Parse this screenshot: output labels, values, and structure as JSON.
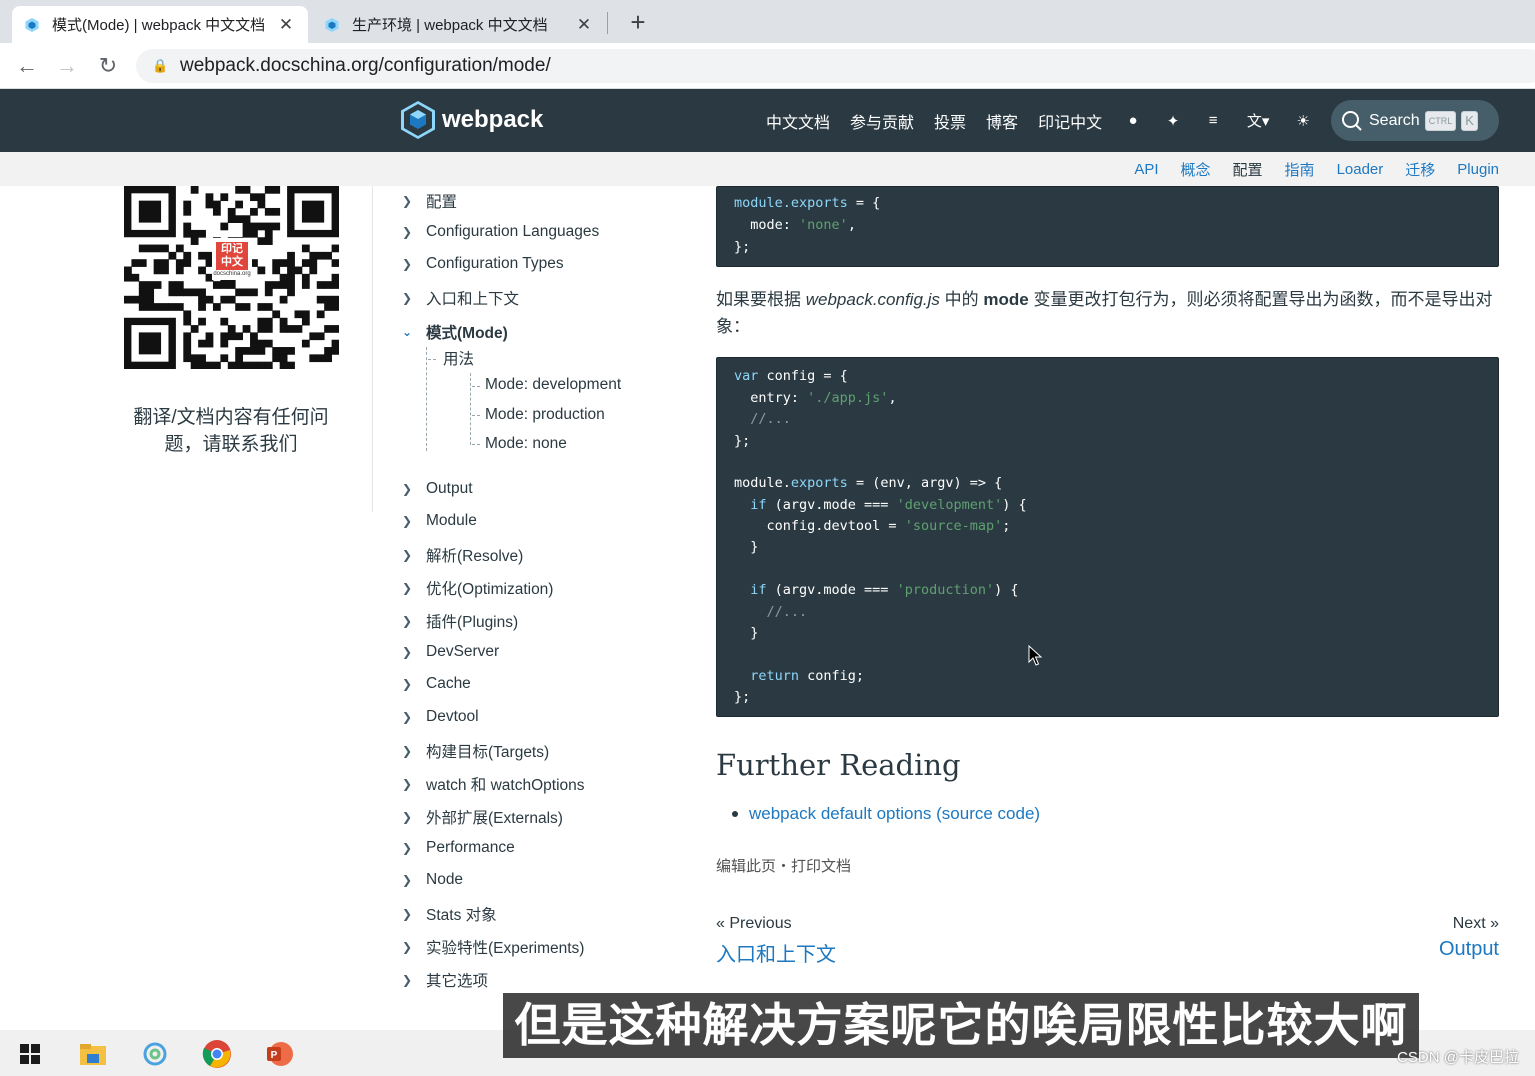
{
  "browser": {
    "tabs": [
      {
        "title": "模式(Mode) | webpack 中文文档",
        "active": true
      },
      {
        "title": "生产环境 | webpack 中文文档",
        "active": false
      }
    ],
    "url": "webpack.docschina.org/configuration/mode/"
  },
  "header": {
    "logo_text": "webpack",
    "nav": [
      "中文文档",
      "参与贡献",
      "投票",
      "博客",
      "印记中文"
    ],
    "search_label": "Search",
    "search_kbd": [
      "CTRL",
      "K"
    ]
  },
  "subnav": [
    "API",
    "概念",
    "配置",
    "指南",
    "Loader",
    "迁移",
    "Plugin"
  ],
  "left": {
    "qr_badge": "印记中文",
    "qr_small": "docschina.org",
    "contact": "翻译/文档内容有任何问题，请联系我们"
  },
  "sidebar": {
    "items_top": [
      "配置",
      "Configuration Languages",
      "Configuration Types",
      "入口和上下文"
    ],
    "open_item": "模式(Mode)",
    "sub_section": "用法",
    "sub_items": [
      "Mode: development",
      "Mode: production",
      "Mode: none"
    ],
    "items_bottom": [
      "Output",
      "Module",
      "解析(Resolve)",
      "优化(Optimization)",
      "插件(Plugins)",
      "DevServer",
      "Cache",
      "Devtool",
      "构建目标(Targets)",
      "watch 和 watchOptions",
      "外部扩展(Externals)",
      "Performance",
      "Node",
      "Stats 对象",
      "实验特性(Experiments)",
      "其它选项"
    ]
  },
  "content": {
    "code1": {
      "l1_kw": "module.exports",
      "l1_rest": " = {",
      "l2_key": "  mode: ",
      "l2_str": "'none'",
      "l2_end": ",",
      "l3": "};"
    },
    "para_1": "如果要根据 ",
    "para_file": "webpack.config.js",
    "para_2": " 中的 ",
    "para_mode": "mode",
    "para_3": " 变量更改打包行为，则必须将配置导出为函数，而不是导出对象：",
    "code2": {
      "l1a": "var",
      "l1b": " config = {",
      "l2a": "  entry: ",
      "l2b": "'./app.js'",
      "l2c": ",",
      "l3": "  //...",
      "l4": "};",
      "l6a": "module.",
      "l6b": "exports",
      "l6c": " = (env, argv) => {",
      "l7a": "  if",
      "l7b": " (argv.mode === ",
      "l7c": "'development'",
      "l7d": ") {",
      "l8a": "    config.devtool = ",
      "l8b": "'source-map'",
      "l8c": ";",
      "l9": "  }",
      "l11a": "  if",
      "l11b": " (argv.mode === ",
      "l11c": "'production'",
      "l11d": ") {",
      "l12": "    //...",
      "l13": "  }",
      "l15a": "  return",
      "l15b": " config;",
      "l16": "};"
    },
    "heading": "Further Reading",
    "reading_link": "webpack default options (source code)",
    "edit_links": "编辑此页・打印文档",
    "prev_label": "« Previous",
    "prev_link": "入口和上下文",
    "next_label": "Next »",
    "next_link": "Output"
  },
  "overlay": {
    "subtitle": "但是这种解决方案呢它的唉局限性比较大啊",
    "watermark": "CSDN @卡皮巴拉"
  }
}
